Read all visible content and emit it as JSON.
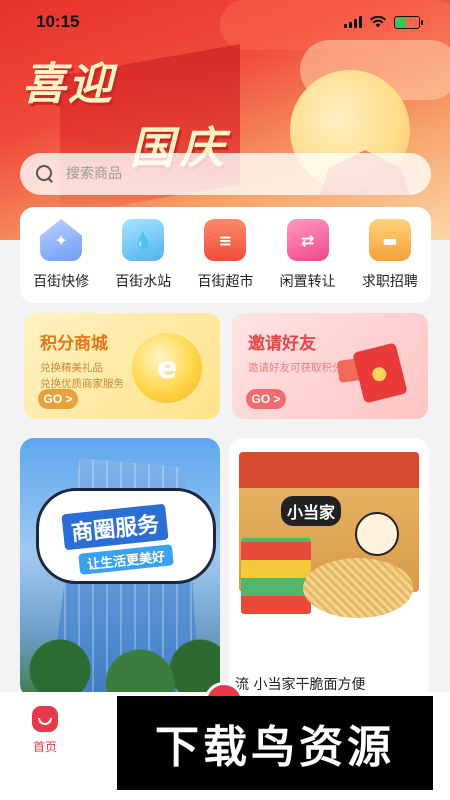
{
  "status_bar": {
    "time": "10:15"
  },
  "banner": {
    "line1": "喜迎",
    "line2": "国庆"
  },
  "search": {
    "placeholder": "搜索商品"
  },
  "services": [
    {
      "label": "百街快修",
      "icon": "wrench-house-icon"
    },
    {
      "label": "百街水站",
      "icon": "water-bottle-icon"
    },
    {
      "label": "百街超市",
      "icon": "shopping-basket-icon"
    },
    {
      "label": "闲置转让",
      "icon": "swap-arrows-icon"
    },
    {
      "label": "求职招聘",
      "icon": "briefcase-icon"
    }
  ],
  "promos": {
    "points": {
      "title": "积分商城",
      "line1": "兑换精美礼品",
      "line2": "兑换优质商家服务",
      "go": "GO >"
    },
    "invite": {
      "title": "邀请好友",
      "line1": "邀请好友可获取积分",
      "go": "GO >"
    }
  },
  "features": {
    "business": {
      "title": "商圈服务",
      "subtitle": "让生活更美好"
    },
    "product": {
      "brand": "小当家",
      "caption": "流 小当家干脆面方便"
    }
  },
  "tabbar": {
    "home": "首页"
  },
  "watermark": "下载鸟资源",
  "colors": {
    "accent": "#e8384a",
    "points": "#e2761b",
    "invite": "#e8444a"
  }
}
